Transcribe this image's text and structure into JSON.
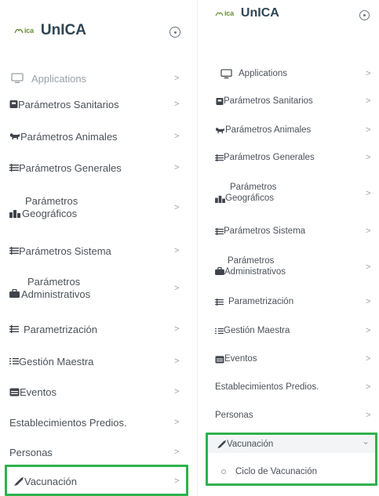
{
  "brand": {
    "title": "UnICA",
    "logo_text": "ica"
  },
  "left_menu": {
    "items": [
      {
        "label": "Applications",
        "icon": "monitor-icon"
      },
      {
        "label": "Parámetros Sanitarios",
        "icon": "clipboard-icon"
      },
      {
        "label": "Parámetros Animales",
        "icon": "cow-icon"
      },
      {
        "label": "Parámetros Generales",
        "icon": "list-icon"
      },
      {
        "label": "Parámetros Geográficos",
        "line1": "Parámetros",
        "line2": "Geográficos",
        "icon": "buildings-icon"
      },
      {
        "label": "Parámetros Sistema",
        "icon": "list-icon"
      },
      {
        "label": "Parámetros Administrativos",
        "line1": "Parámetros",
        "line2": "Administrativos",
        "icon": "briefcase-icon"
      },
      {
        "label": "Parametrización",
        "icon": "list-icon"
      },
      {
        "label": "Gestión Maestra",
        "icon": "checklist-icon"
      },
      {
        "label": "Eventos",
        "icon": "calendar-icon"
      },
      {
        "label": "Establecimientos Predios.",
        "icon": ""
      },
      {
        "label": "Personas",
        "icon": ""
      },
      {
        "label": "Vacunación",
        "icon": "syringe-icon"
      }
    ]
  },
  "right_menu": {
    "items": [
      {
        "label": "Applications"
      },
      {
        "label": "Parámetros Sanitarios"
      },
      {
        "label": "Parámetros Animales"
      },
      {
        "label": "Parámetros Generales"
      },
      {
        "label": "Parámetros Geográficos",
        "line1": "Parámetros",
        "line2": "Geográficos"
      },
      {
        "label": "Parámetros Sistema"
      },
      {
        "label": "Parámetros Administrativos",
        "line1": "Parámetros",
        "line2": "Administrativos"
      },
      {
        "label": "Parametrización"
      },
      {
        "label": "Gestión Maestra"
      },
      {
        "label": "Eventos"
      },
      {
        "label": "Establecimientos Predios."
      },
      {
        "label": "Personas"
      },
      {
        "label": "Vacunación"
      }
    ],
    "submenu": [
      {
        "label": "Ciclo de Vacunación"
      }
    ]
  },
  "chevron_collapsed": ">",
  "chevron_expanded": "⌄",
  "highlight_color": "#2fb14d"
}
